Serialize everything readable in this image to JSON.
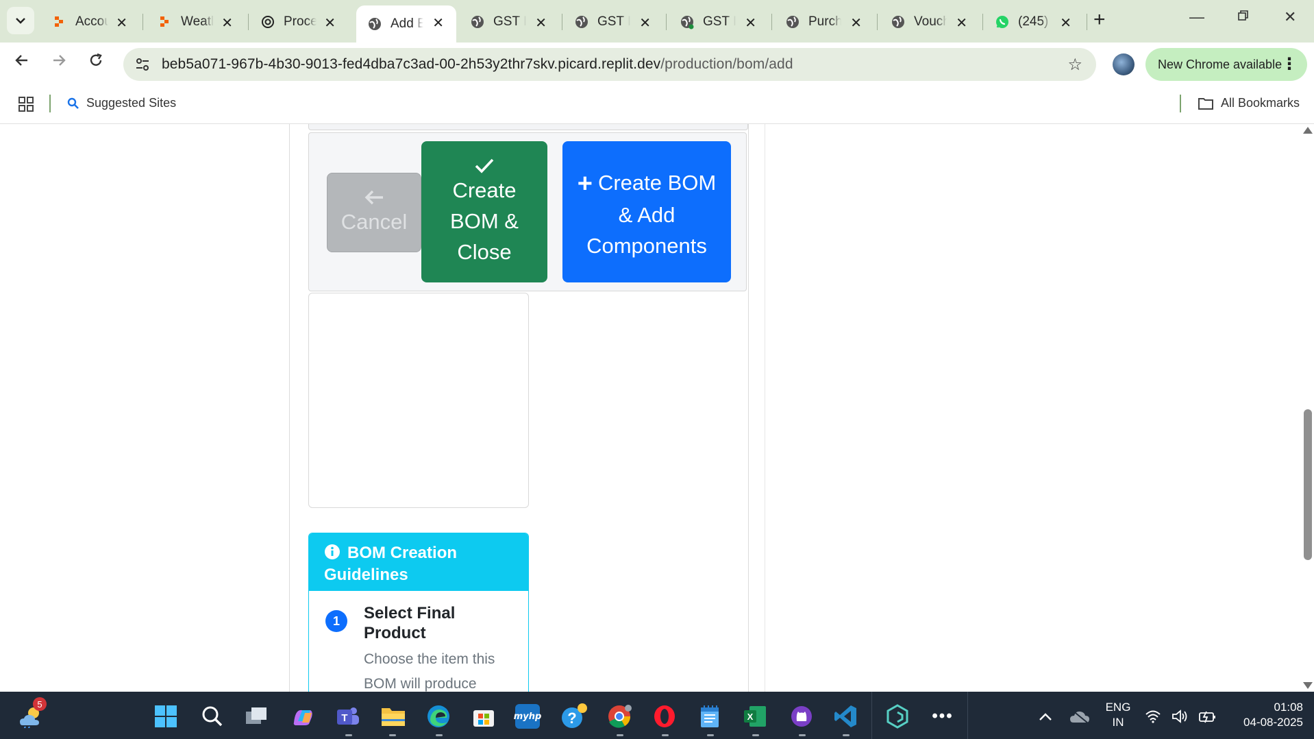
{
  "browser": {
    "tabs": [
      {
        "title": "Accou",
        "icon": "replit-icon",
        "active": false
      },
      {
        "title": "Weatl",
        "icon": "replit-icon",
        "active": false
      },
      {
        "title": "Proce",
        "icon": "openai-icon",
        "active": false
      },
      {
        "title": "Add E",
        "icon": "globe-icon",
        "active": true
      },
      {
        "title": "GST Ir",
        "icon": "globe-icon",
        "active": false
      },
      {
        "title": "GST Ir",
        "icon": "globe-icon",
        "active": false
      },
      {
        "title": "GST Ir",
        "icon": "globe-icon",
        "active": false
      },
      {
        "title": "Purch",
        "icon": "globe-icon",
        "active": false
      },
      {
        "title": "Vouch",
        "icon": "globe-icon",
        "active": false
      },
      {
        "title": "(245)",
        "icon": "whatsapp-icon",
        "active": false
      }
    ],
    "url_host": "beb5a071-967b-4b30-9013-fed4dba7c3ad-00-2h53y2thr7skv.picard.replit.dev",
    "url_path": "/production/bom/add",
    "update_label": "New Chrome available",
    "bookmarks": {
      "suggested": "Suggested Sites",
      "all": "All Bookmarks"
    }
  },
  "page": {
    "actions": {
      "cancel_label": "Cancel",
      "create_close_label": "Create BOM & Close",
      "create_add_label": "Create BOM & Add Components"
    },
    "guidelines": {
      "title": "BOM Creation Guidelines",
      "steps": [
        {
          "number": "1",
          "title": "Select Final Product",
          "description": "Choose the item this BOM will produce"
        }
      ]
    }
  },
  "colors": {
    "success": "#1f8654",
    "primary": "#0d6efd",
    "info": "#0dcaf0",
    "secondary": "#b4b7ba"
  },
  "taskbar": {
    "weather_badge": "5",
    "language": "ENG",
    "region": "IN",
    "time": "01:08",
    "date": "04-08-2025"
  }
}
